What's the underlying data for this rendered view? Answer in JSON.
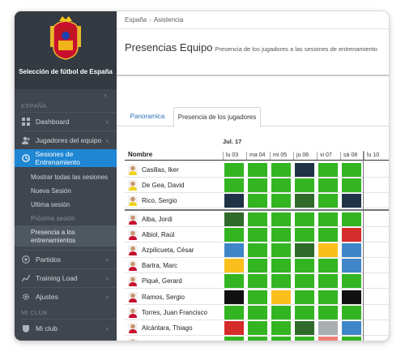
{
  "colors": {
    "green": "#33b522",
    "dark": "#1f3346",
    "darkgreen": "#2f6a2a",
    "yellow": "#fbbf1d",
    "blue": "#3f86c9",
    "red": "#d62b2b",
    "black": "#111111",
    "gray": "#a9aeb3",
    "salmon": "#f08076",
    "sidebar_active": "#1f86d4"
  },
  "sidebar": {
    "brand": "Selección de fútbol de España",
    "section1": "ESPAÑA",
    "items": [
      {
        "label": "Dashboard",
        "icon": "dashboard-icon"
      },
      {
        "label": "Jugadores del equipo",
        "icon": "users-icon"
      },
      {
        "label": "Sesiones de Entrenamiento",
        "icon": "training-icon"
      }
    ],
    "subitems": [
      "Mostrar todas las sesiones",
      "Nueva Sesión",
      "Ultima sesión",
      "Próxima sesión",
      "Presencia a los entrenamientos"
    ],
    "items2": [
      {
        "label": "Partidos",
        "icon": "soccer-ball-icon"
      },
      {
        "label": "Training Load",
        "icon": "chart-icon"
      },
      {
        "label": "Ajustes",
        "icon": "gear-icon"
      }
    ],
    "section2": "MI CLUB",
    "items3": [
      {
        "label": "Mi club",
        "icon": "club-icon"
      }
    ]
  },
  "breadcrumb": {
    "home": "España",
    "current": "Asistencia"
  },
  "page": {
    "title": "Presencias Equipo",
    "subtitle": "Presencia de los jugadores a las sesiones de entrenamiento"
  },
  "tabs": [
    "Panoramica",
    "Presencia de los jugadores"
  ],
  "attendance": {
    "month": "Jul. 17",
    "name_header": "Nombre",
    "days": [
      "lu 03",
      "ma 04",
      "mi 05",
      "ju 06",
      "vi 07",
      "sá 08",
      "lu 10"
    ],
    "players": [
      {
        "name": "Casillas, Iker",
        "cells": [
          "green",
          "green",
          "green",
          "dark",
          "green",
          "green"
        ],
        "kit": "yellow"
      },
      {
        "name": "De Gea, David",
        "cells": [
          "green",
          "green",
          "green",
          "green",
          "green",
          "green"
        ],
        "kit": "yellow"
      },
      {
        "name": "Rico, Sergio",
        "cells": [
          "dark",
          "green",
          "green",
          "darkgreen",
          "green",
          "dark"
        ],
        "kit": "yellow"
      },
      {
        "name": "Alba, Jordi",
        "cells": [
          "darkgreen",
          "green",
          "green",
          "green",
          "green",
          "green"
        ],
        "kit": "red"
      },
      {
        "name": "Albiol, Raúl",
        "cells": [
          "green",
          "green",
          "green",
          "green",
          "green",
          "red"
        ],
        "kit": "red"
      },
      {
        "name": "Azpilicueta, César",
        "cells": [
          "blue",
          "green",
          "green",
          "darkgreen",
          "yellow",
          "blue"
        ],
        "kit": "red"
      },
      {
        "name": "Bartra, Marc",
        "cells": [
          "yellow",
          "green",
          "green",
          "green",
          "green",
          "blue"
        ],
        "kit": "red"
      },
      {
        "name": "Piqué, Gerard",
        "cells": [
          "green",
          "green",
          "green",
          "green",
          "green",
          "green"
        ],
        "kit": "red"
      },
      {
        "name": "Ramos, Sergio",
        "cells": [
          "black",
          "green",
          "yellow",
          "green",
          "green",
          "black"
        ],
        "kit": "red"
      },
      {
        "name": "Torres, Juan Francisco",
        "cells": [
          "green",
          "green",
          "green",
          "green",
          "green",
          "green"
        ],
        "kit": "red"
      },
      {
        "name": "Alcántara, Thiago",
        "cells": [
          "red",
          "green",
          "green",
          "darkgreen",
          "gray",
          "blue"
        ],
        "kit": "red"
      },
      {
        "name": "Busquets, Sergio",
        "cells": [
          "green",
          "green",
          "green",
          "green",
          "salmon",
          "green"
        ],
        "kit": "red"
      }
    ]
  }
}
